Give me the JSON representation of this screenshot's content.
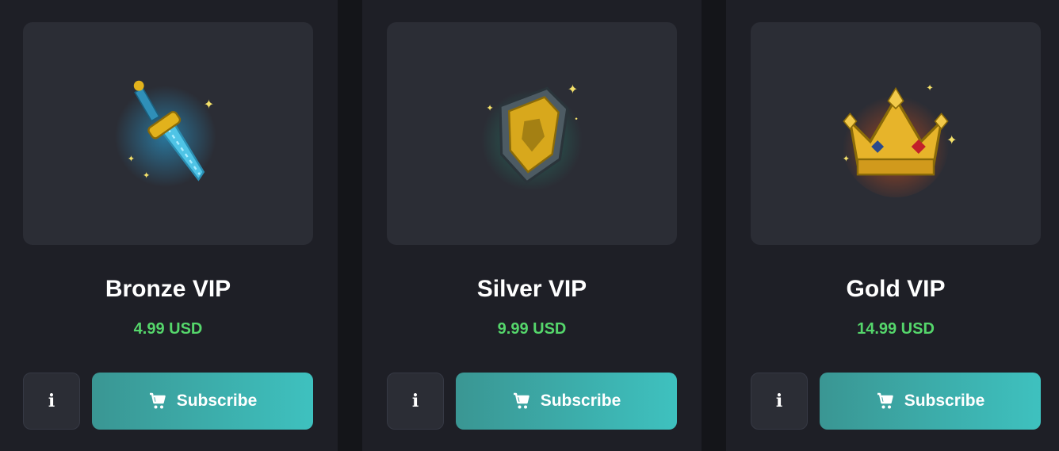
{
  "tiers": [
    {
      "name": "Bronze VIP",
      "price": "4.99 USD",
      "icon": "diamond-sword-icon",
      "subscribe_label": "Subscribe",
      "info_label": "i"
    },
    {
      "name": "Silver VIP",
      "price": "9.99 USD",
      "icon": "golden-shield-icon",
      "subscribe_label": "Subscribe",
      "info_label": "i"
    },
    {
      "name": "Gold VIP",
      "price": "14.99 USD",
      "icon": "golden-crown-icon",
      "subscribe_label": "Subscribe",
      "info_label": "i"
    }
  ],
  "colors": {
    "price": "#55d66b",
    "button_start": "#3a9693",
    "button_end": "#3ec1bf",
    "card": "#1e1f26",
    "image_box": "#2b2d35"
  }
}
